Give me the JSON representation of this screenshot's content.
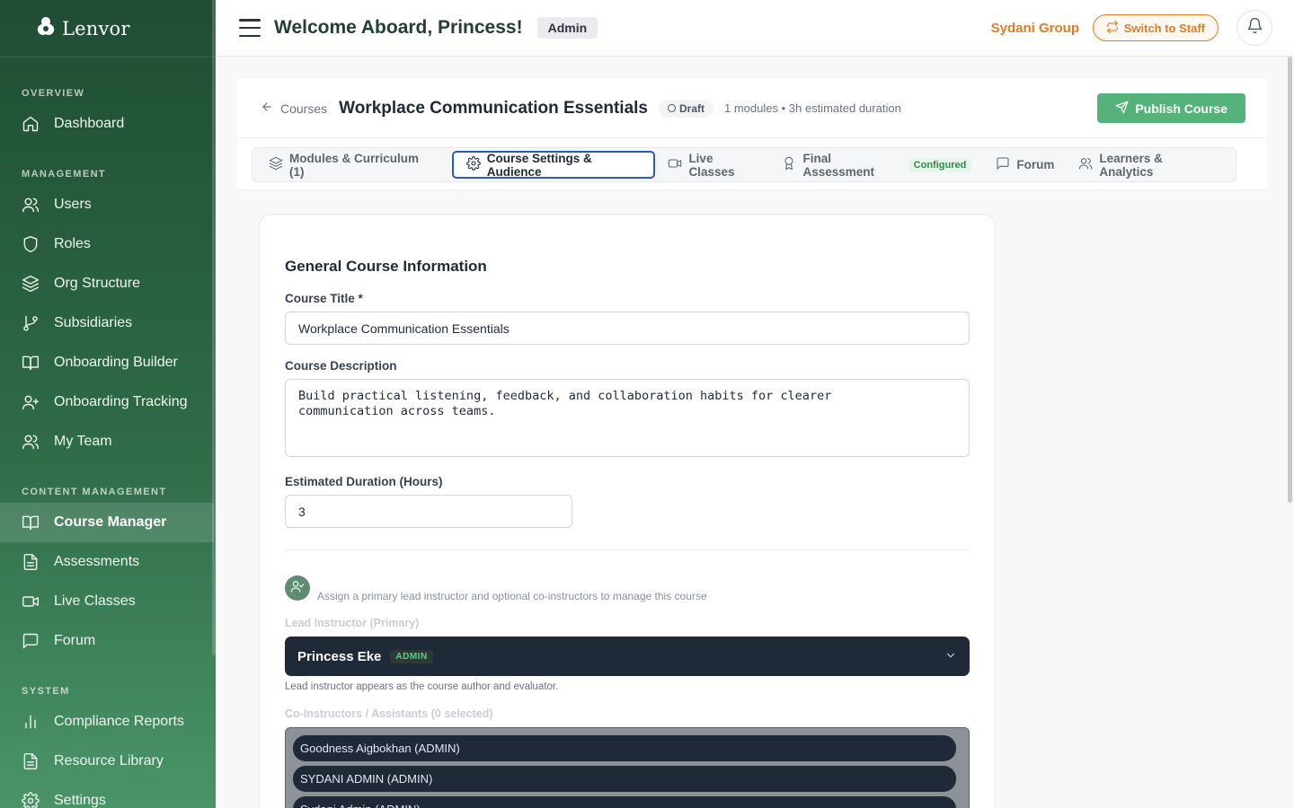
{
  "brand": {
    "name": "Lenvor"
  },
  "sidebar": {
    "sections": {
      "overview": "OVERVIEW",
      "management": "MANAGEMENT",
      "content": "CONTENT MANAGEMENT",
      "system": "SYSTEM"
    },
    "items": [
      {
        "label": "Dashboard",
        "icon": "home-icon"
      },
      {
        "label": "Users",
        "icon": "users-icon"
      },
      {
        "label": "Roles",
        "icon": "shield-icon"
      },
      {
        "label": "Org Structure",
        "icon": "layers-icon"
      },
      {
        "label": "Subsidiaries",
        "icon": "git-branch-icon"
      },
      {
        "label": "Onboarding Builder",
        "icon": "book-open-icon"
      },
      {
        "label": "Onboarding Tracking",
        "icon": "user-plus-icon"
      },
      {
        "label": "My Team",
        "icon": "users-icon"
      },
      {
        "label": "Course Manager",
        "icon": "book-open-icon",
        "active": true
      },
      {
        "label": "Assessments",
        "icon": "file-text-icon"
      },
      {
        "label": "Live Classes",
        "icon": "video-icon"
      },
      {
        "label": "Forum",
        "icon": "message-square-icon"
      },
      {
        "label": "Compliance Reports",
        "icon": "bar-chart-icon"
      },
      {
        "label": "Resource Library",
        "icon": "file-text-icon"
      },
      {
        "label": "Settings",
        "icon": "gear-icon"
      }
    ]
  },
  "header": {
    "welcome": "Welcome Aboard, Princess!",
    "role": "Admin",
    "org": "Sydani Group",
    "switch_label": "Switch to Staff"
  },
  "course": {
    "back_label": "Courses",
    "title": "Workplace Communication Essentials",
    "status": "Draft",
    "meta": "1 modules • 3h estimated duration",
    "publish_label": "Publish Course"
  },
  "tabs": [
    {
      "label": "Modules & Curriculum (1)",
      "icon": "layers-icon"
    },
    {
      "label": "Course Settings & Audience",
      "icon": "gear-icon",
      "active": true
    },
    {
      "label": "Live Classes",
      "icon": "video-icon"
    },
    {
      "label": "Final Assessment",
      "icon": "award-icon",
      "badge": "Configured"
    },
    {
      "label": "Forum",
      "icon": "message-square-icon"
    },
    {
      "label": "Learners & Analytics",
      "icon": "users-icon"
    }
  ],
  "form": {
    "section_title": "General Course Information",
    "title_label": "Course Title *",
    "title_value": "Workplace Communication Essentials",
    "desc_label": "Course Description",
    "desc_value": "Build practical listening, feedback, and collaboration habits for clearer\ncommunication across teams.",
    "duration_label": "Estimated Duration (Hours)",
    "duration_value": "3",
    "instructor_help": "Assign a primary lead instructor and optional co-instructors to manage this course",
    "lead_label": "Lead Instructor (Primary)",
    "lead_name": "Princess Eke",
    "lead_badge": "ADMIN",
    "lead_hint": "Lead instructor appears as the course author and evaluator.",
    "co_label": "Co-Instructors / Assistants (0 selected)",
    "co_options": [
      "Goodness Aigbokhan (ADMIN)",
      "SYDANI ADMIN (ADMIN)",
      "Sydani Admin (ADMIN)"
    ]
  }
}
